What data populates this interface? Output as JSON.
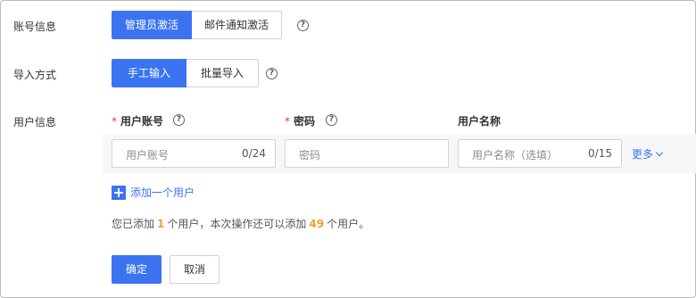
{
  "account_info": {
    "label": "账号信息",
    "options": [
      "管理员激活",
      "邮件通知激活"
    ],
    "selected": "管理员激活"
  },
  "import_method": {
    "label": "导入方式",
    "options": [
      "手工输入",
      "批量导入"
    ],
    "selected": "手工输入"
  },
  "user_info": {
    "label": "用户信息",
    "columns": {
      "account": "用户账号",
      "password": "密码",
      "name": "用户名称"
    },
    "account_field": {
      "placeholder": "用户账号",
      "count": "0/24"
    },
    "password_field": {
      "placeholder": "密码"
    },
    "name_field": {
      "placeholder": "用户名称（选填）",
      "count": "0/15"
    },
    "more_label": "更多"
  },
  "add_user_label": "添加一个用户",
  "summary": {
    "prefix": "您已添加",
    "added": "1",
    "middle": "个用户，本次操作还可以添加",
    "remaining": "49",
    "suffix": "个用户。"
  },
  "buttons": {
    "confirm": "确定",
    "cancel": "取消"
  },
  "help_glyph": "?",
  "required_mark": "*",
  "colors": {
    "primary": "#3b73f0",
    "required": "#e0403a",
    "highlight": "#f0a030"
  }
}
